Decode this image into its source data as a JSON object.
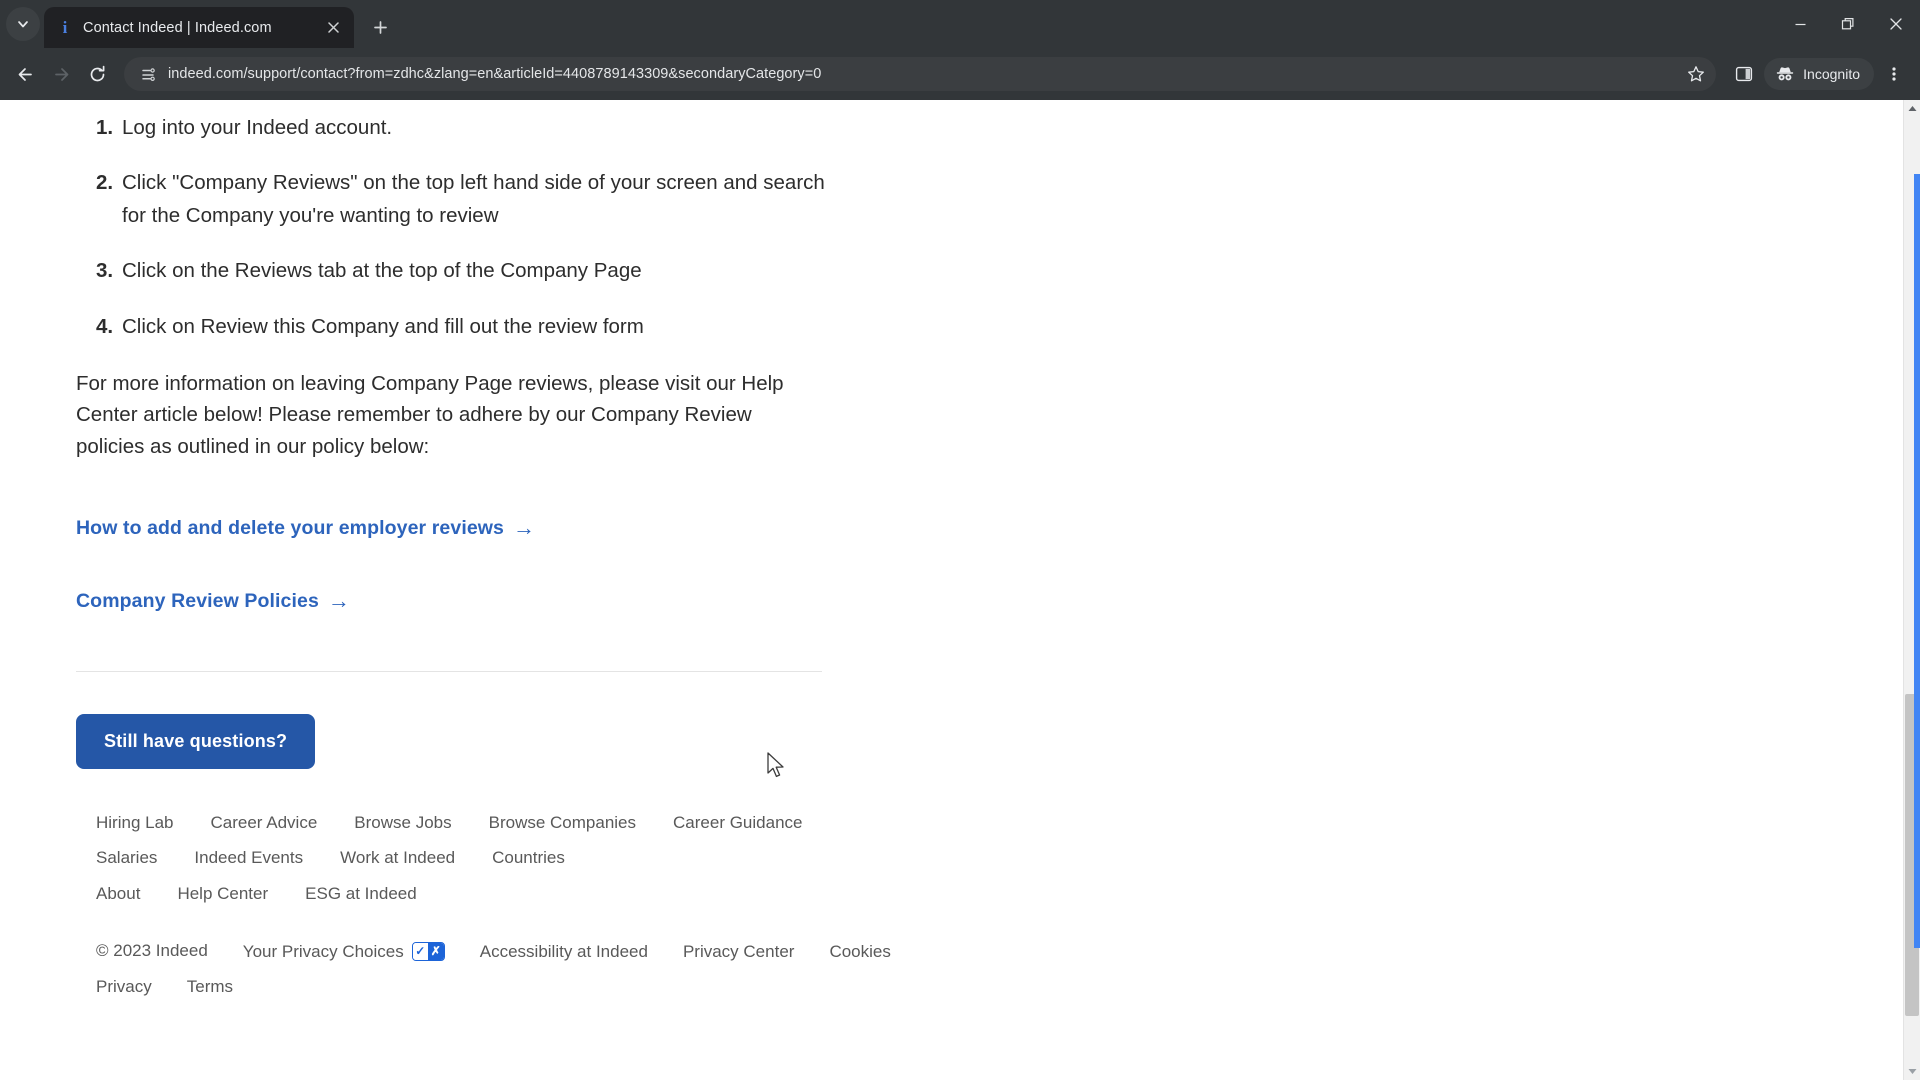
{
  "browser": {
    "tab_search_icon": "chevron-down-icon",
    "tab": {
      "favicon": "indeed-favicon",
      "favicon_letter": "i",
      "title": "Contact Indeed | Indeed.com",
      "close_icon": "close-icon"
    },
    "new_tab_label": "+",
    "window_controls": {
      "minimize": "minimize-icon",
      "restore": "restore-icon",
      "close": "close-icon"
    },
    "toolbar": {
      "back_icon": "back-arrow-icon",
      "forward_icon": "forward-arrow-icon",
      "reload_icon": "reload-icon",
      "site_info_icon": "page-info-icon",
      "url": "indeed.com/support/contact?from=zdhc&zlang=en&articleId=4408789143309&secondaryCategory=0",
      "bookmark_icon": "star-icon",
      "side_panel_icon": "side-panel-icon",
      "incognito_icon": "incognito-spy-icon",
      "incognito_label": "Incognito",
      "menu_icon": "three-dot-menu-icon"
    },
    "scrollbar": {
      "up_icon": "scroll-up-arrow-icon",
      "down_icon": "scroll-down-arrow-icon"
    }
  },
  "page": {
    "steps": [
      "Log into your Indeed account.",
      "Click \"Company Reviews\" on the top left hand side of your screen and search for the Company you're wanting to review",
      "Click on the Reviews tab at the top of the Company Page",
      "Click on Review this Company and fill out the review form"
    ],
    "paragraph": "For more information on leaving Company Page reviews, please visit our Help Center article below! Please remember to adhere by our Company Review policies as outlined in our policy below:",
    "links": [
      {
        "label": "How to add and delete your employer reviews",
        "arrow": "→"
      },
      {
        "label": "Company Review Policies",
        "arrow": "→"
      }
    ],
    "cta_label": "Still have questions?",
    "footer": {
      "primary_links": [
        "Hiring Lab",
        "Career Advice",
        "Browse Jobs",
        "Browse Companies",
        "Career Guidance",
        "Salaries",
        "Indeed Events",
        "Work at Indeed",
        "Countries"
      ],
      "secondary_links": [
        "About",
        "Help Center",
        "ESG at Indeed"
      ],
      "copyright": "© 2023 Indeed",
      "privacy_choices_label": "Your Privacy Choices",
      "privacy_badge_check": "✓",
      "privacy_badge_x": "✗",
      "legal_links": [
        "Accessibility at Indeed",
        "Privacy Center",
        "Cookies",
        "Privacy",
        "Terms"
      ]
    }
  },
  "colors": {
    "chrome_bg": "#323639",
    "tab_active": "#202124",
    "link_blue": "#2d64bc",
    "cta_blue": "#2557a7",
    "footer_text": "#595959",
    "scroll_focus": "#4285f4"
  }
}
